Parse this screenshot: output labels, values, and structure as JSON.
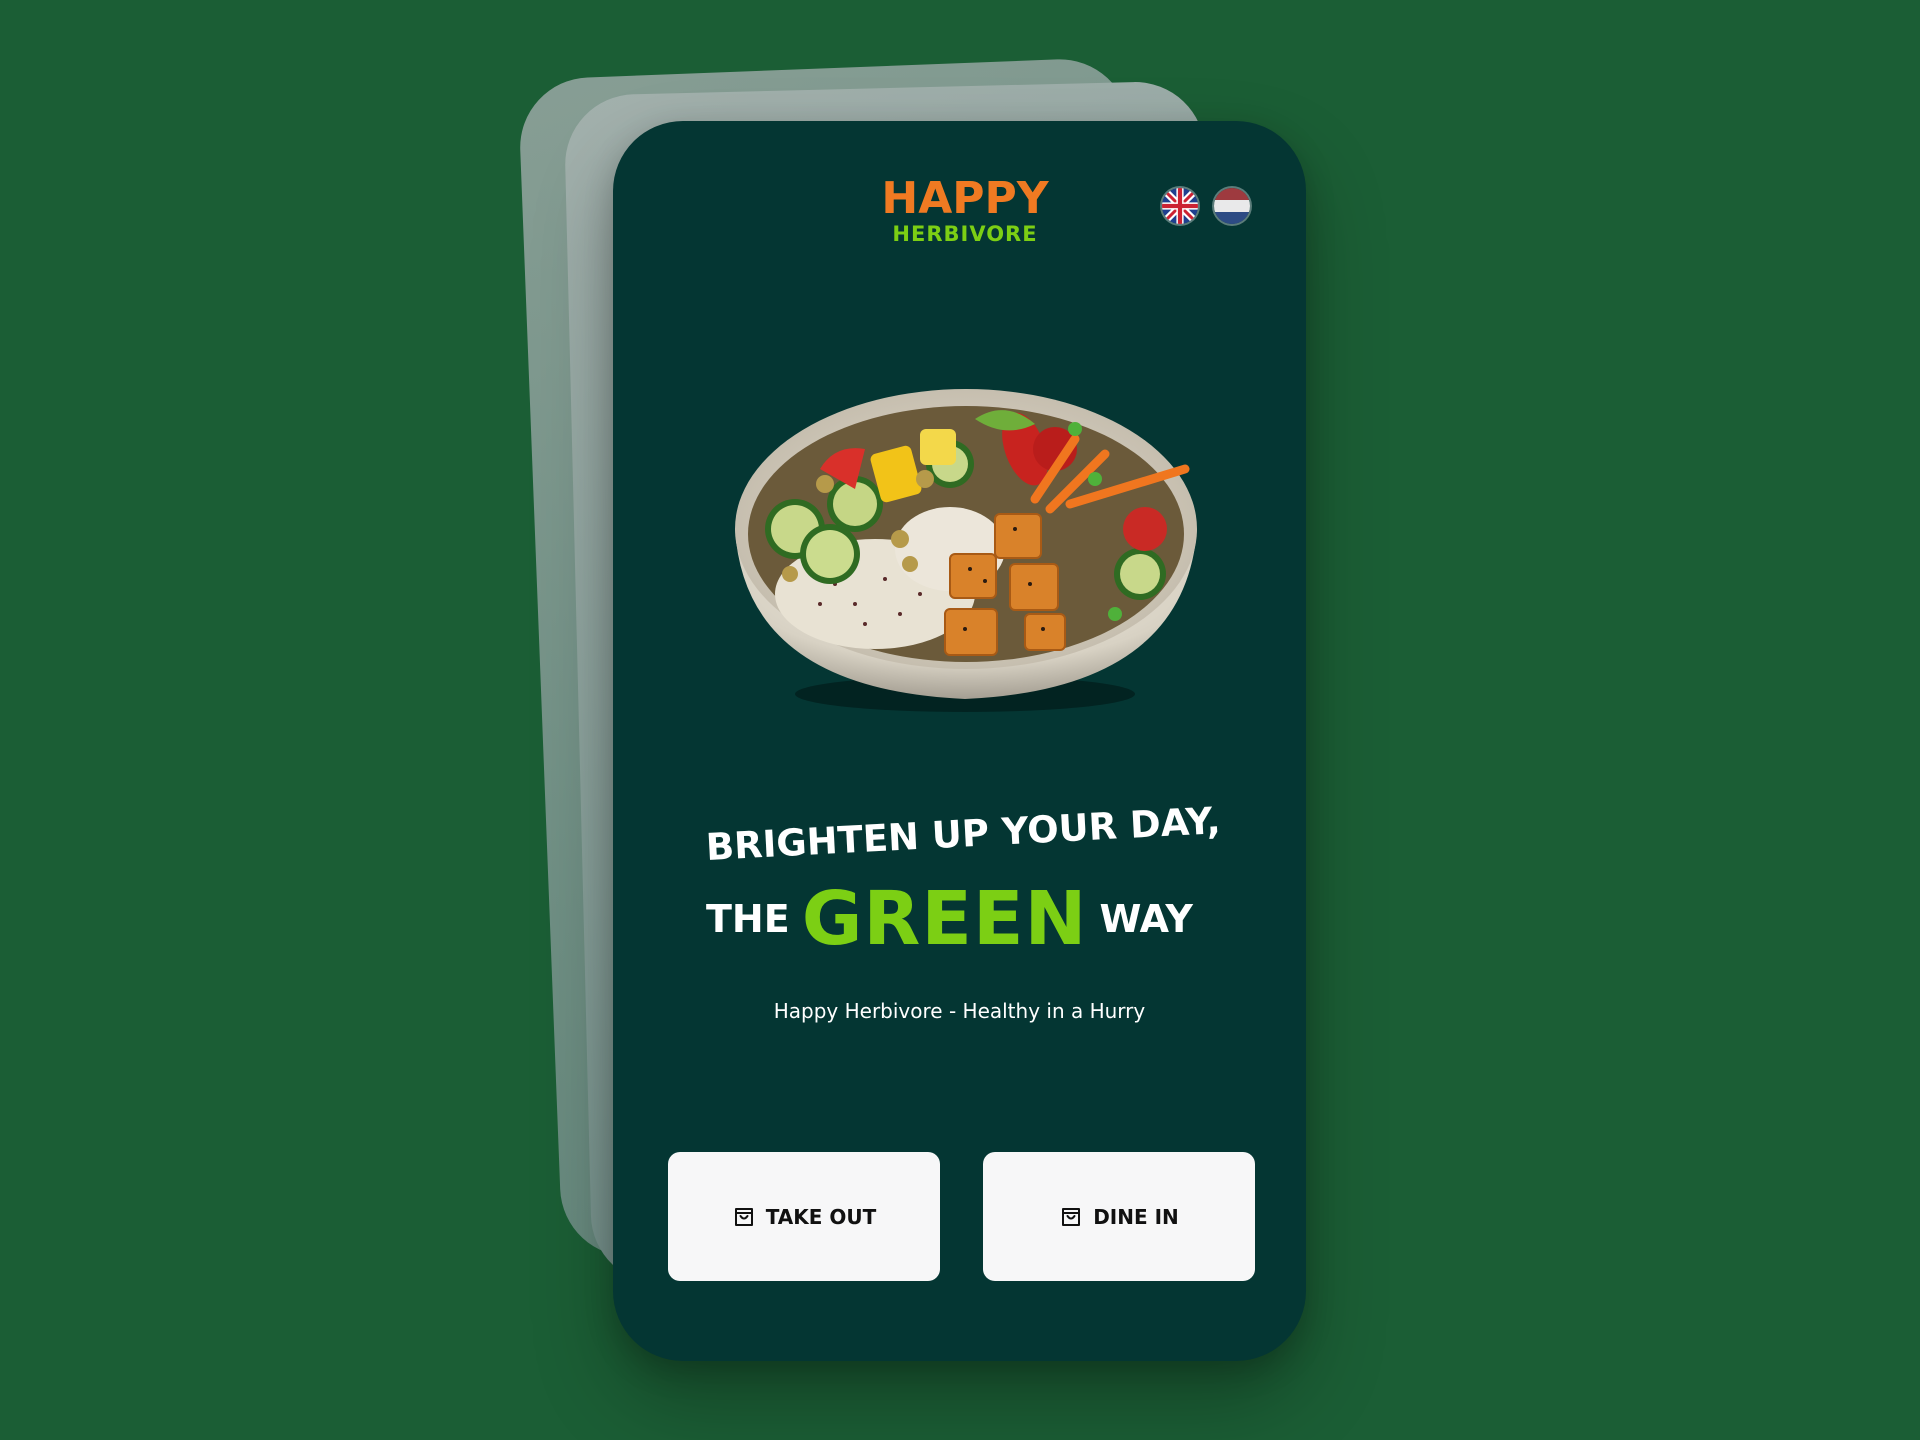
{
  "logo": {
    "top": "HAPPY",
    "bottom": "HERBIVORE"
  },
  "languages": [
    {
      "name": "English",
      "icon": "uk-flag-icon"
    },
    {
      "name": "Dutch",
      "icon": "nl-flag-icon"
    }
  ],
  "hero": {
    "image": "vegan-bowl-image"
  },
  "headline": {
    "line1": "BRIGHTEN UP YOUR DAY,",
    "the": "THE",
    "green": "GREEN",
    "way": "WAY"
  },
  "tagline": "Happy Herbivore - Healthy in a Hurry",
  "buttons": {
    "take_out": "TAKE OUT",
    "dine_in": "DINE IN",
    "icon": "shopping-bag-icon"
  },
  "colors": {
    "background": "#1b5e35",
    "phone": "#043633",
    "orange": "#f07a22",
    "green": "#7ccf14",
    "button": "#f7f7f8"
  }
}
